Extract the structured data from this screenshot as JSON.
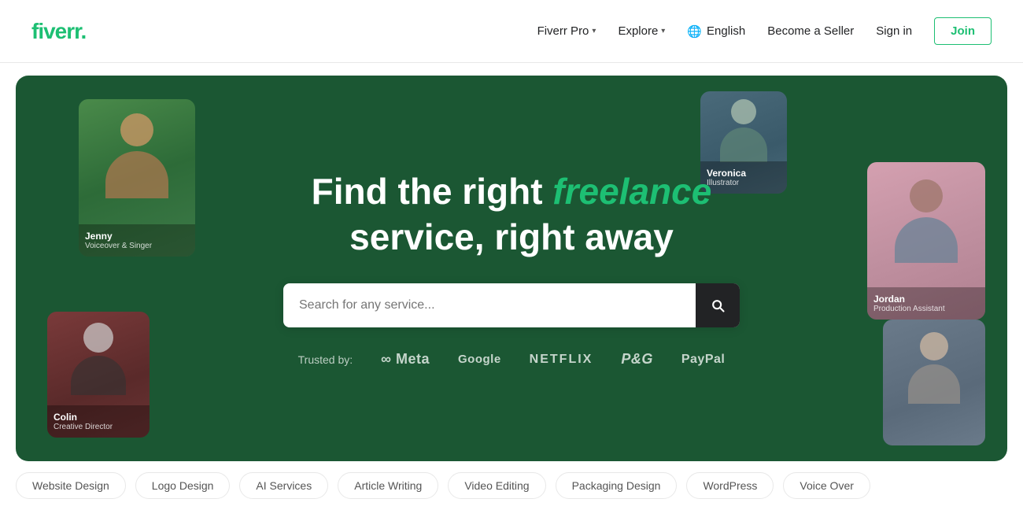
{
  "navbar": {
    "logo_text": "fiverr",
    "logo_dot": ".",
    "fiverr_pro_label": "Fiverr Pro",
    "explore_label": "Explore",
    "language_label": "English",
    "become_seller_label": "Become a Seller",
    "signin_label": "Sign in",
    "join_label": "Join"
  },
  "hero": {
    "title_part1": "Find the right ",
    "title_accent": "freelance",
    "title_part2": "service, right away",
    "search_placeholder": "Search for any service...",
    "trusted_label": "Trusted by:",
    "trusted_logos": [
      "∞ Meta",
      "Google",
      "NETFLIX",
      "P&G",
      "PayPal"
    ]
  },
  "freelancers": [
    {
      "id": "jenny",
      "name": "Jenny",
      "title": "Voiceover & Singer"
    },
    {
      "id": "colin",
      "name": "Colin",
      "title": "Creative Director"
    },
    {
      "id": "veronica",
      "name": "Veronica",
      "title": "Illustrator"
    },
    {
      "id": "jordan",
      "name": "Jordan",
      "title": "Production Assistant"
    }
  ],
  "bottom_pills": [
    "Website Design",
    "Logo Design",
    "AI Services",
    "Article Writing",
    "Video Editing",
    "Packaging Design",
    "WordPress",
    "Voice Over"
  ]
}
